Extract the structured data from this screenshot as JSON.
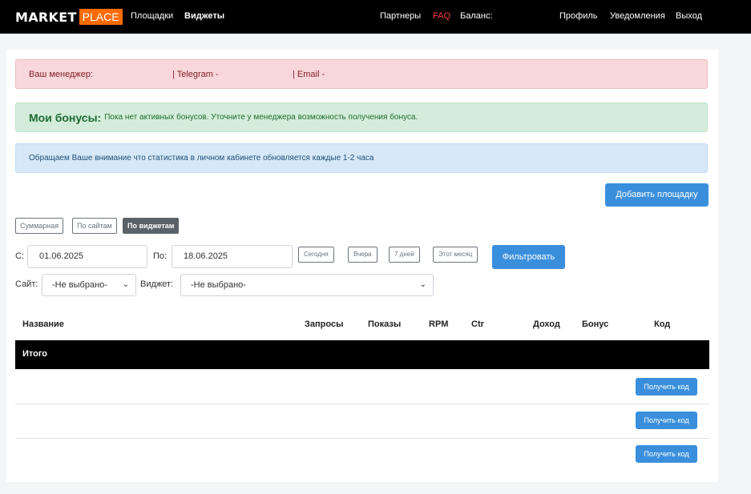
{
  "navbar": {
    "logo_main": "MARKET",
    "logo_accent": "PLACE",
    "left_links": [
      "Площадки",
      "Виджеты"
    ],
    "partners": "Партнеры",
    "faq": "FAQ",
    "balance": "Баланс:",
    "profile": "Профиль",
    "notifications": "Уведомления",
    "logout": "Выход"
  },
  "alerts": {
    "manager_label": "Ваш менеджер:",
    "telegram_label": "| Telegram -",
    "email_label": "| Email -",
    "bonus_title": "Мои бонусы:",
    "bonus_text": "Пока нет активных бонусов. Уточните у менеджера возможность получения бонуса.",
    "stats_notice": "Обращаем Ваше внимание что статистика в личном кабинете обновляется каждые 1-2 часа"
  },
  "add_site_button": "Добавить площадку",
  "view_tabs": [
    "Суммарная",
    "По сайтам",
    "По виджетам"
  ],
  "filters": {
    "from_label": "С:",
    "from_value": "01.06.2025",
    "to_label": "По:",
    "to_value": "18.06.2025",
    "quick_ranges": [
      "Сегодня",
      "Вчера",
      "7 дней",
      "Этот месяц"
    ],
    "filter_button": "Фильтровать",
    "site_label": "Сайт:",
    "site_selected": "-Не выбрано-",
    "widget_label": "Виджет:",
    "widget_selected": "-Не выбрано-"
  },
  "table": {
    "columns": [
      "Название",
      "Запросы",
      "Показы",
      "RPM",
      "Ctr",
      "Доход",
      "Бонус",
      "Код"
    ],
    "total_label": "Итого",
    "get_code_label": "Получить код"
  },
  "colors": {
    "accent_orange": "#ff6b00",
    "primary_blue": "#3a8fdc",
    "faq_red": "#ff3b3b"
  }
}
